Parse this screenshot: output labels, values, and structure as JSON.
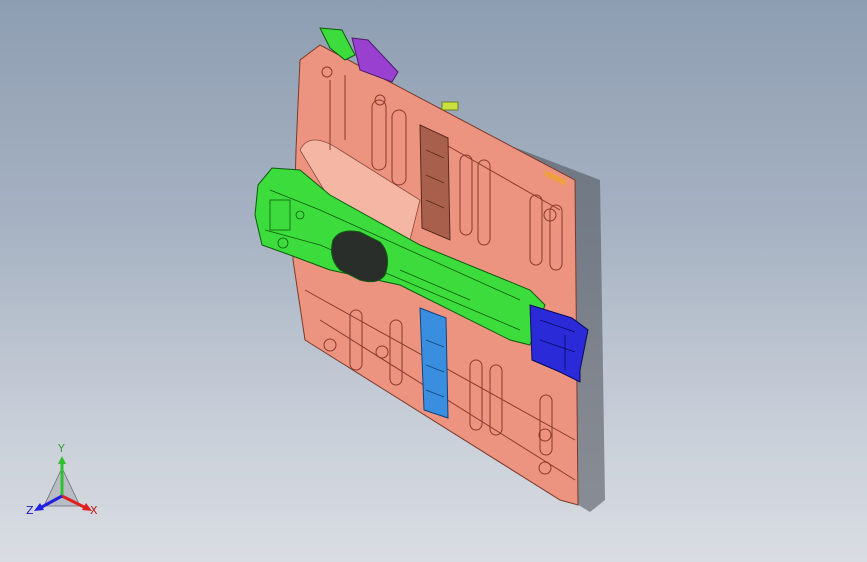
{
  "view": {
    "background_top": "#8e9eb2",
    "background_bottom": "#d9dde3"
  },
  "model": {
    "description_colors": {
      "panel": "#e8907a",
      "frame": "#3ad63a",
      "bracket_blue": "#2a2ad8",
      "plate_blue": "#3a8ee0",
      "brown_plate": "#a0604a",
      "purple": "#9a40d0",
      "yellow": "#c8e040"
    }
  },
  "triad": {
    "y_label": "Y",
    "x_label": "X",
    "z_label": "Z",
    "y_color": "#30c030",
    "x_color": "#e02020",
    "z_color": "#2020e0"
  }
}
